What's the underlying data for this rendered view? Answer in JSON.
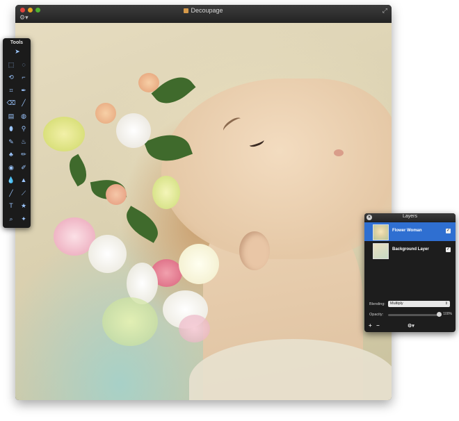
{
  "window": {
    "title": "Decoupage",
    "gear_glyph": "⚙▾",
    "expand_glyph": "⤢"
  },
  "tools_palette": {
    "title": "Tools",
    "tools": [
      {
        "name": "move-tool",
        "glyph": "➤"
      },
      {
        "name": "marquee-rect-tool",
        "glyph": "⬚"
      },
      {
        "name": "marquee-ellipse-tool",
        "glyph": "◌"
      },
      {
        "name": "lasso-tool",
        "glyph": "⟲"
      },
      {
        "name": "polygon-lasso-tool",
        "glyph": "⌐"
      },
      {
        "name": "crop-tool",
        "glyph": "⌗"
      },
      {
        "name": "pen-tool",
        "glyph": "✒"
      },
      {
        "name": "eraser-tool",
        "glyph": "⌫"
      },
      {
        "name": "line-tool",
        "glyph": "╱"
      },
      {
        "name": "gradient-tool",
        "glyph": "▤"
      },
      {
        "name": "globe-tool",
        "glyph": "◍"
      },
      {
        "name": "fill-shape-tool",
        "glyph": "⬮"
      },
      {
        "name": "dropper-tool",
        "glyph": "⚲"
      },
      {
        "name": "brush-tool",
        "glyph": "✎"
      },
      {
        "name": "burn-tool",
        "glyph": "♨"
      },
      {
        "name": "stamp-tool",
        "glyph": "♣"
      },
      {
        "name": "pencil-tool",
        "glyph": "✏"
      },
      {
        "name": "eye-tool",
        "glyph": "◉"
      },
      {
        "name": "smudge-tool",
        "glyph": "✐"
      },
      {
        "name": "drop-tool",
        "glyph": "💧"
      },
      {
        "name": "sharpen-tool",
        "glyph": "▲"
      },
      {
        "name": "pen-blue-tool",
        "glyph": "╱"
      },
      {
        "name": "pen-line-tool",
        "glyph": "⟋"
      },
      {
        "name": "text-tool",
        "glyph": "T"
      },
      {
        "name": "shape-tool",
        "glyph": "★"
      },
      {
        "name": "zoom-tool",
        "glyph": "⌕"
      },
      {
        "name": "wand-tool",
        "glyph": "✦"
      }
    ]
  },
  "layers_panel": {
    "title": "Layers",
    "close_glyph": "×",
    "layers": [
      {
        "name": "Flower Woman",
        "selected": true,
        "visible_glyph": "✓"
      },
      {
        "name": "Background Layer",
        "selected": false,
        "visible_glyph": "✓"
      }
    ],
    "blending_label": "Blending:",
    "blending_value": "Multiply",
    "blending_arrow": "⇕",
    "opacity_label": "Opacity:",
    "opacity_value": "100%",
    "opacity_fraction": 1.0,
    "add_glyph": "+",
    "remove_glyph": "−",
    "settings_glyph": "⚙▾"
  },
  "colors": {
    "selection": "#2f6fd1",
    "tool_icon": "#9cc6ff"
  }
}
